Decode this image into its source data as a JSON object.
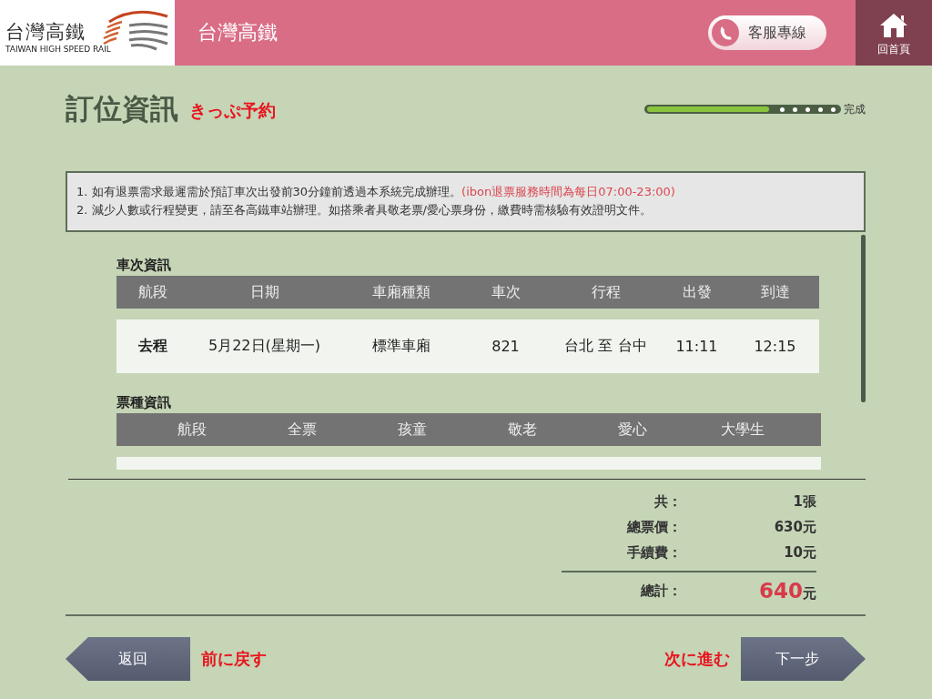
{
  "header": {
    "logo_text": "台灣高鐵",
    "logo_subtext": "TAIWAN HIGH SPEED RAIL",
    "title": "台灣高鐵",
    "hotline_button": "客服專線",
    "home_button": "回首頁"
  },
  "page": {
    "title": "訂位資訊",
    "subtitle": "きっぷ予約"
  },
  "progress": {
    "level": 0.65,
    "label": "完成"
  },
  "notices": [
    {
      "text": "1. 如有退票需求最遲需於預訂車次出發前30分鐘前透過本系統完成辦理。",
      "note": "(ibon退票服務時間為每日07:00-23:00)"
    },
    {
      "text": "2. 減少人數或行程變更，請至各高鐵車站辦理。如搭乘者具敬老票/愛心票身份，繳費時需核驗有效證明文件。"
    }
  ],
  "train_info": {
    "title": "車次資訊",
    "columns": [
      "航段",
      "日期",
      "車廂種類",
      "車次",
      "行程",
      "出發",
      "到達"
    ],
    "rows": [
      [
        "去程",
        "5月22日(星期一)",
        "標準車廂",
        "821",
        "台北 至 台中",
        "11:11",
        "12:15"
      ]
    ]
  },
  "ticket_info": {
    "title": "票種資訊",
    "columns": [
      "航段",
      "全票",
      "孩童",
      "敬老",
      "愛心",
      "大學生"
    ]
  },
  "summary": [
    {
      "label": "共：",
      "value": "1張",
      "kind": "plain"
    },
    {
      "label": "總票價：",
      "value": "630元",
      "kind": "plain"
    },
    {
      "label": "手續費：",
      "value": "10元",
      "kind": "plain"
    },
    {
      "label": "總計：",
      "value": "640",
      "unit": "元",
      "kind": "total"
    }
  ],
  "back_button": "返回",
  "back_hint": "前に戻す",
  "next_hint": "次に進む",
  "next_button": "下一步"
}
